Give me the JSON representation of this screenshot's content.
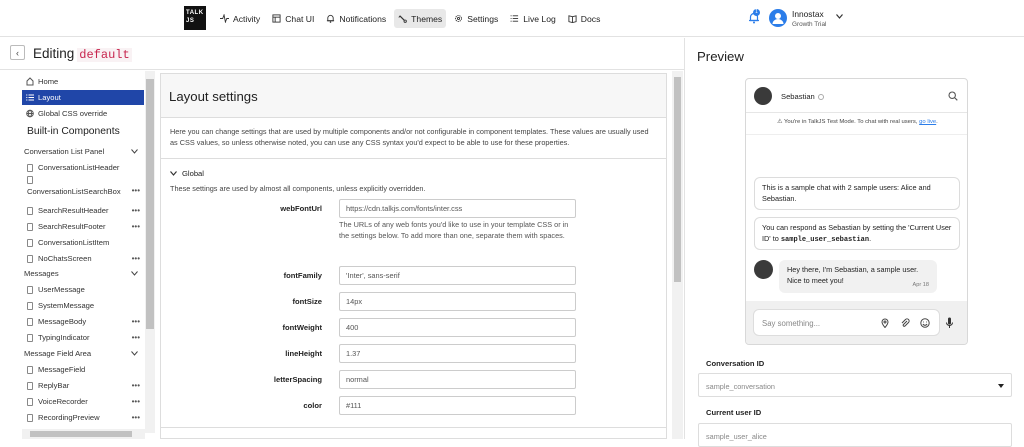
{
  "topbar": {
    "logo_text": "TALK JS",
    "nav": [
      {
        "label": "Activity",
        "icon": "activity-icon"
      },
      {
        "label": "Chat UI",
        "icon": "layout-icon"
      },
      {
        "label": "Notifications",
        "icon": "bell-icon"
      },
      {
        "label": "Themes",
        "icon": "brush-icon",
        "active": true
      },
      {
        "label": "Settings",
        "icon": "gear-icon"
      },
      {
        "label": "Live Log",
        "icon": "list-icon"
      },
      {
        "label": "Docs",
        "icon": "book-icon"
      }
    ],
    "notification_count": "1",
    "account_name": "Innostax",
    "account_plan": "Growth Trial"
  },
  "editor": {
    "title": "Editing",
    "theme_name": "default"
  },
  "sidebar": {
    "items": [
      {
        "label": "Home",
        "kind": "home-icon"
      },
      {
        "label": "Layout",
        "kind": "list-icon",
        "active": true
      },
      {
        "label": "Global CSS override",
        "kind": "globe-icon"
      }
    ],
    "components_heading": "Built-in Components",
    "groups": [
      {
        "label": "Conversation List Panel",
        "items": [
          "ConversationListHeader",
          "ConversationListSearchBox",
          "SearchResultHeader",
          "SearchResultFooter",
          "ConversationListItem",
          "NoChatsScreen"
        ]
      },
      {
        "label": "Messages",
        "items": [
          "UserMessage",
          "SystemMessage",
          "MessageBody",
          "TypingIndicator"
        ]
      },
      {
        "label": "Message Field Area",
        "items": [
          "MessageField",
          "ReplyBar",
          "VoiceRecorder",
          "RecordingPreview"
        ]
      }
    ]
  },
  "layout_settings": {
    "title": "Layout settings",
    "description": "Here you can change settings that are used by multiple components and/or not configurable in component templates. These values are usually used as CSS values, so unless otherwise noted, you can use any CSS syntax you'd expect to be able to use for these properties.",
    "global_label": "Global",
    "global_description": "These settings are used by almost all components, unless explicitly overridden.",
    "fields": [
      {
        "label": "webFontUrl",
        "value": "https://cdn.talkjs.com/fonts/inter.css"
      },
      {
        "label": "fontFamily",
        "value": "'Inter', sans-serif"
      },
      {
        "label": "fontSize",
        "value": "14px"
      },
      {
        "label": "fontWeight",
        "value": "400"
      },
      {
        "label": "lineHeight",
        "value": "1.37"
      },
      {
        "label": "letterSpacing",
        "value": "normal"
      },
      {
        "label": "color",
        "value": "#111"
      }
    ],
    "webfont_help": "The URLs of any web fonts you'd like to use in your template CSS or in the settings below. To add more than one, separate them with spaces."
  },
  "preview": {
    "title": "Preview",
    "chat_name": "Sebastian",
    "test_mode_text": "You're in TalkJS Test Mode. To chat with real users,",
    "test_mode_link": "go live",
    "test_mode_end": ".",
    "msg1": "This is a sample chat with 2 sample users: Alice and Sebastian.",
    "msg2_a": "You can respond as Sebastian by setting the 'Current User ID' to",
    "msg2_code": "sample_user_sebastian",
    "msg2_b": ".",
    "msg3": "Hey there, I'm Sebastian, a sample user. Nice to meet you!",
    "msg3_time": "Apr 18",
    "compose_placeholder": "Say something...",
    "conversation_id_label": "Conversation ID",
    "conversation_id_value": "sample_conversation",
    "current_user_label": "Current user ID",
    "current_user_value": "sample_user_alice"
  },
  "colors": {
    "accent": "#2046a8",
    "link": "#2b7de9",
    "code": "#c7254e"
  }
}
